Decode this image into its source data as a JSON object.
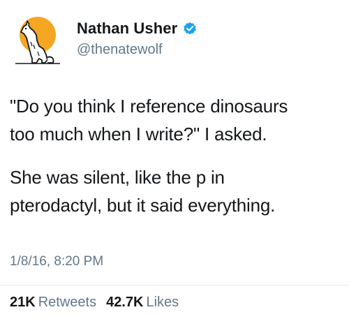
{
  "author": {
    "display_name": "Nathan Usher",
    "handle": "@thenatewolf",
    "verified": true,
    "avatar_icon": "howling-wolf-moon-avatar"
  },
  "tweet": {
    "paragraph_1": "\"Do you think I reference dinosaurs\ntoo much when I write?\" I asked.",
    "paragraph_2": "She was silent, like the p in\npterodactyl, but it said everything.",
    "timestamp": "1/8/16, 8:20 PM"
  },
  "stats": {
    "retweets_count": "21K",
    "retweets_label": "Retweets",
    "likes_count": "42.7K",
    "likes_label": "Likes"
  },
  "colors": {
    "text": "#14171a",
    "secondary": "#657786",
    "verified_blue": "#1da1f2",
    "avatar_moon": "#f5a623",
    "divider": "#e6ecf0"
  }
}
